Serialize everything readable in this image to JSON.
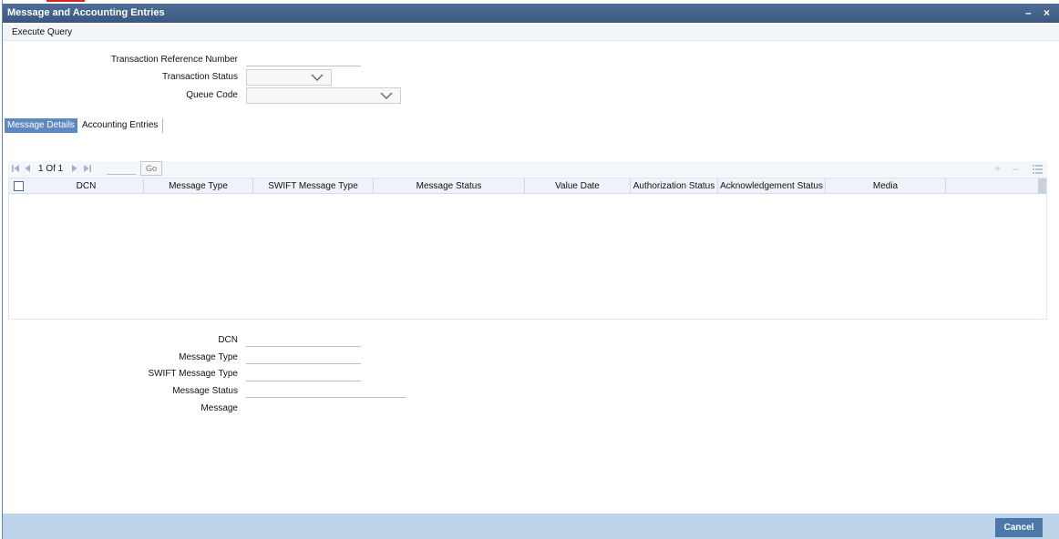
{
  "window": {
    "title": "Message and Accounting Entries",
    "minimize_glyph": "–",
    "close_glyph": "×"
  },
  "toolbar": {
    "execute_query_label": "Execute Query"
  },
  "form": {
    "transaction_reference_label": "Transaction Reference Number",
    "transaction_reference_value": "",
    "transaction_status_label": "Transaction Status",
    "transaction_status_value": "",
    "queue_code_label": "Queue Code",
    "queue_code_value": ""
  },
  "tabs": [
    {
      "label": "Message Details",
      "active": true
    },
    {
      "label": "Accounting Entries",
      "active": false
    }
  ],
  "grid": {
    "pagination_text": "1 Of 1",
    "page_input_value": "",
    "go_label": "Go",
    "columns": [
      "DCN",
      "Message Type",
      "SWIFT Message Type",
      "Message Status",
      "Value Date",
      "Authorization Status",
      "Acknowledgement Status",
      "Media"
    ],
    "rows": []
  },
  "detail": {
    "dcn_label": "DCN",
    "dcn_value": "",
    "message_type_label": "Message Type",
    "message_type_value": "",
    "swift_message_type_label": "SWIFT Message Type",
    "swift_message_type_value": "",
    "message_status_label": "Message Status",
    "message_status_value": "",
    "message_label": "Message"
  },
  "footer": {
    "cancel_label": "Cancel"
  },
  "colors": {
    "titlebar": "#4a6a93",
    "active_tab": "#5e88c2",
    "footer": "#bcd3ea",
    "button": "#4a78a8"
  }
}
